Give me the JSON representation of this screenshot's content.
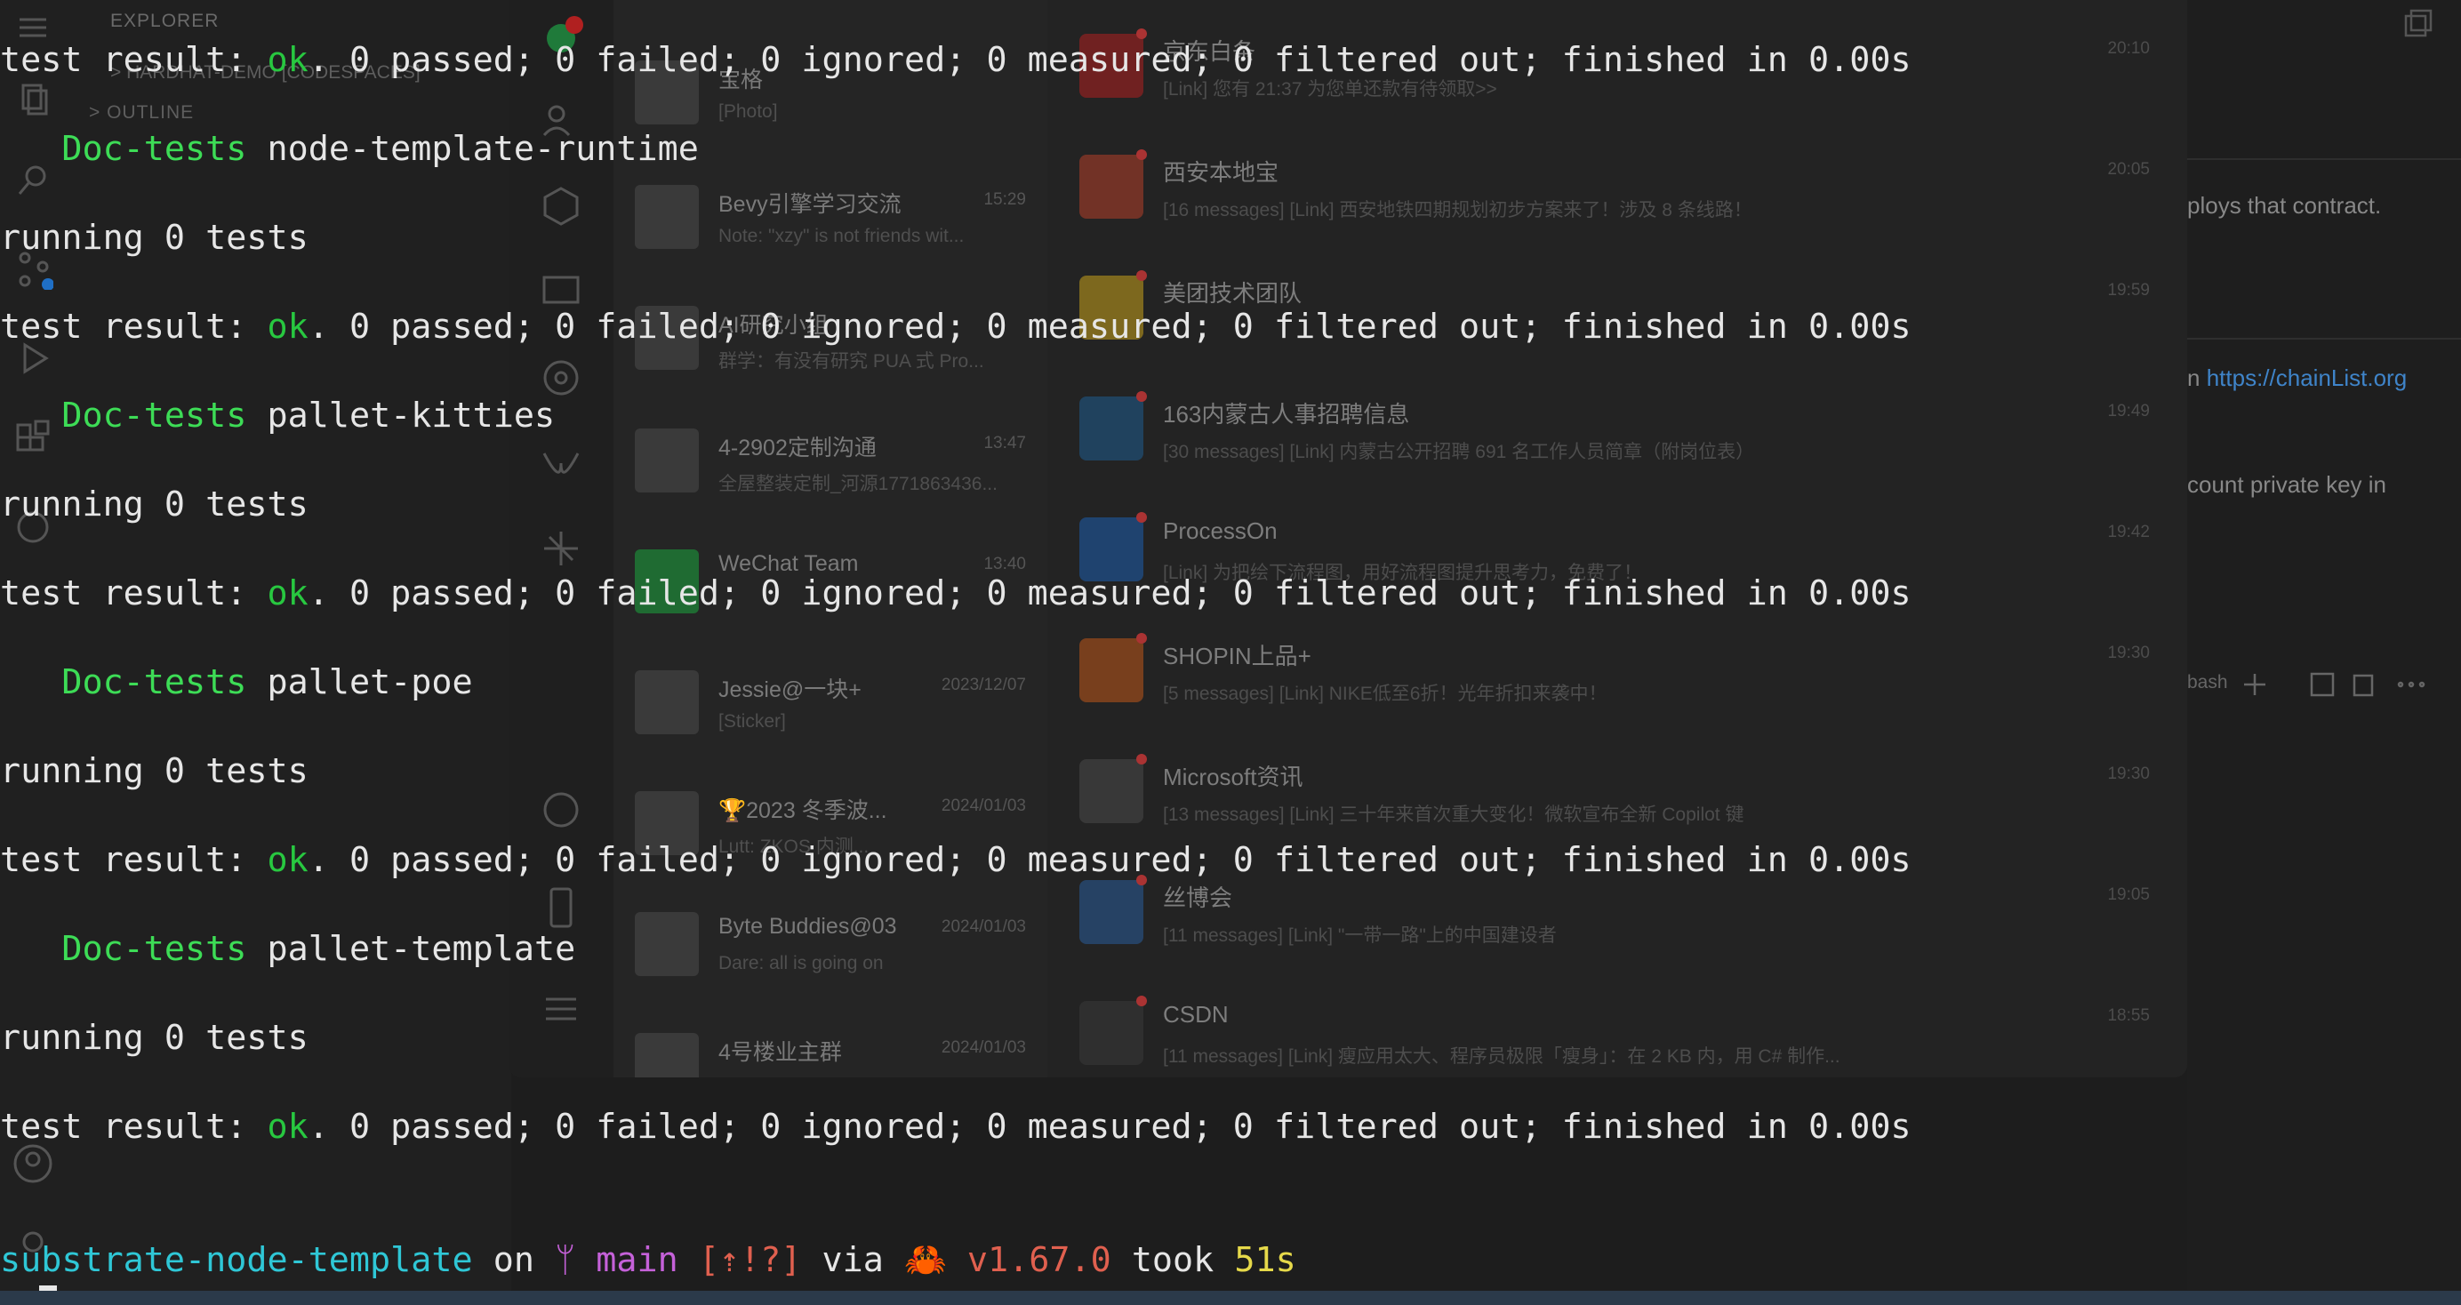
{
  "vscode": {
    "explorer_title": "EXPLORER",
    "folder": "> HARDHAT-DEMO [CODESPACES]",
    "outline": "> OUTLINE"
  },
  "wechat": {
    "chats": [
      {
        "name": "宝格",
        "time": "",
        "preview": "[Photo]"
      },
      {
        "name": "Bevy引擎学习交流",
        "time": "15:29",
        "preview": "Note: \"xzy\" is not friends wit..."
      },
      {
        "name": "AI研究小组",
        "time": "",
        "preview": "群学：有没有研究 PUA 式 Pro..."
      },
      {
        "name": "4-2902定制沟通",
        "time": "13:47",
        "preview": "全屋整装定制_河源1771863436..."
      },
      {
        "name": "WeChat Team",
        "time": "13:40",
        "preview": ""
      },
      {
        "name": "Jessie@一块+",
        "time": "2023/12/07",
        "preview": "[Sticker]"
      },
      {
        "name": "🏆2023 冬季波...",
        "time": "2024/01/03",
        "preview": "Lutt: ZKOS 内测..."
      },
      {
        "name": "Byte Buddies@03",
        "time": "2024/01/03",
        "preview": "Dare: all is going  on"
      },
      {
        "name": "4号楼业主群",
        "time": "2024/01/03",
        "preview": ""
      }
    ],
    "accounts": [
      {
        "name": "京东白条",
        "time": "20:10",
        "preview": "[Link] 您有 21:37 为您单还款有待领取>>",
        "color": "#b02020"
      },
      {
        "name": "西安本地宝",
        "time": "20:05",
        "preview": "[16 messages] [Link] 西安地铁四期规划初步方案来了！涉及 8 条线路！",
        "color": "#b5402a"
      },
      {
        "name": "美团技术团队",
        "time": "19:59",
        "preview": "",
        "color": "#c8a21b"
      },
      {
        "name": "163内蒙古人事招聘信息",
        "time": "19:49",
        "preview": "[30 messages] [Link] 内蒙古公开招聘 691 名工作人员简章（附岗位表）",
        "color": "#1f5d8f"
      },
      {
        "name": "ProcessOn",
        "time": "19:42",
        "preview": "[Link] 为把绘下流程图，用好流程图提升思考力，免费了！",
        "color": "#1d5fae"
      },
      {
        "name": "SHOPIN上品+",
        "time": "19:30",
        "preview": "[5 messages] [Link] NIKE低至6折！光年折扣来袭中！",
        "color": "#c0581a"
      },
      {
        "name": "Microsoft资讯",
        "time": "19:30",
        "preview": "[13 messages] [Link] 三十年来首次重大变化！微软宣布全新 Copilot 键",
        "color": "#4a4a4a"
      },
      {
        "name": "丝博会",
        "time": "19:05",
        "preview": "[11 messages] [Link] \"一带一路\"上的中国建设者",
        "color": "#2a5c9a"
      },
      {
        "name": "CSDN",
        "time": "18:55",
        "preview": "[11 messages] [Link] 瘦应用太大、程序员极限「瘦身」：在 2 KB 内，用 C# 制作...",
        "color": "#3a3a3a"
      }
    ]
  },
  "editor": {
    "line1": "ploys that contract.",
    "link_prefix": "n",
    "link": "https://chainList.org",
    "line3": "count private key in",
    "toolbar_label": "bash"
  },
  "terminal": {
    "result_prefix": "test result: ",
    "ok": "ok",
    "result_suffix": ". 0 passed; 0 failed; 0 ignored; 0 measured; 0 filtered out; finished in 0.00s",
    "doc_label": "Doc-tests",
    "running": "running 0 tests",
    "crates": [
      "node-template-runtime",
      "pallet-kitties",
      "pallet-poe",
      "pallet-template"
    ],
    "prompt": {
      "dir": "substrate-node-template",
      "on": " on ",
      "branch_icon": "ᛘ",
      "branch": "main",
      "status": "[⇡!?]",
      "via": " via ",
      "rust_icon": "🦀",
      "version": "v1.67.0",
      "took": " took ",
      "duration": "51s"
    }
  }
}
